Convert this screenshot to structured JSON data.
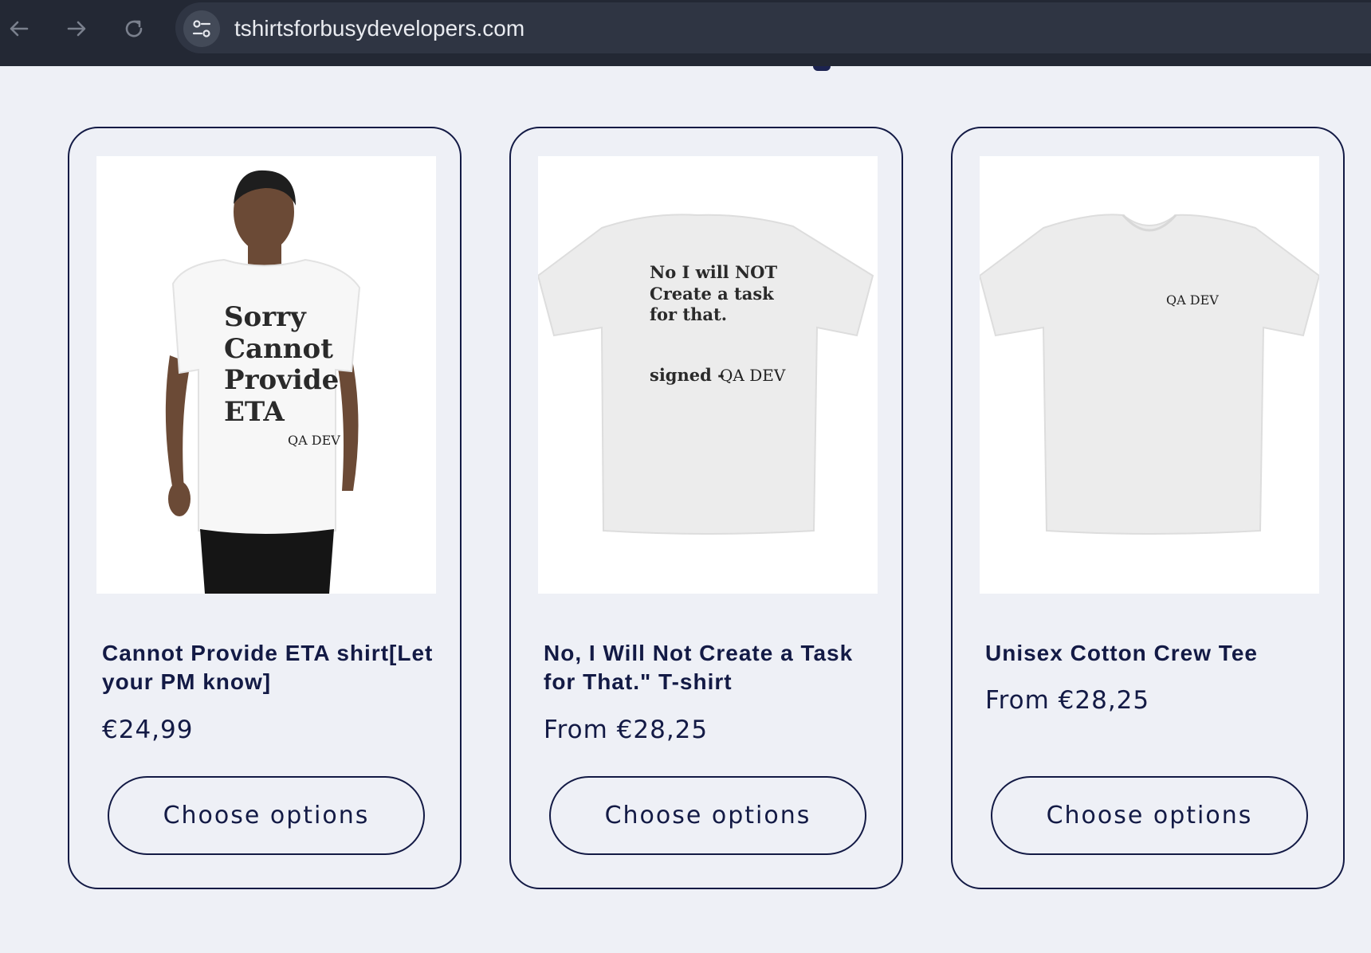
{
  "browser": {
    "url": "tshirtsforbusydevelopers.com",
    "back_icon": "arrow-left-icon",
    "forward_icon": "arrow-right-icon",
    "reload_icon": "reload-icon",
    "site_info_icon": "site-settings-icon"
  },
  "colors": {
    "page_bg": "#eef0f6",
    "accent": "#131a45",
    "browser_bar": "#232834"
  },
  "products": [
    {
      "title": "Cannot Provide ETA shirt[Let your PM know]",
      "price": "€24,99",
      "button_label": "Choose options",
      "image_text": [
        "Sorry",
        "Cannot",
        "Provide",
        "ETA"
      ],
      "image_logo": "QA DEV"
    },
    {
      "title": "No, I Will Not Create a Task for That.\" T-shirt",
      "price": "From €28,25",
      "button_label": "Choose options",
      "image_text": [
        "No I will NOT",
        "Create a task",
        "for that."
      ],
      "image_signed": "signed -",
      "image_logo": "QA DEV"
    },
    {
      "title": "Unisex Cotton Crew Tee",
      "price": "From €28,25",
      "button_label": "Choose options",
      "image_logo": "QA DEV"
    }
  ]
}
